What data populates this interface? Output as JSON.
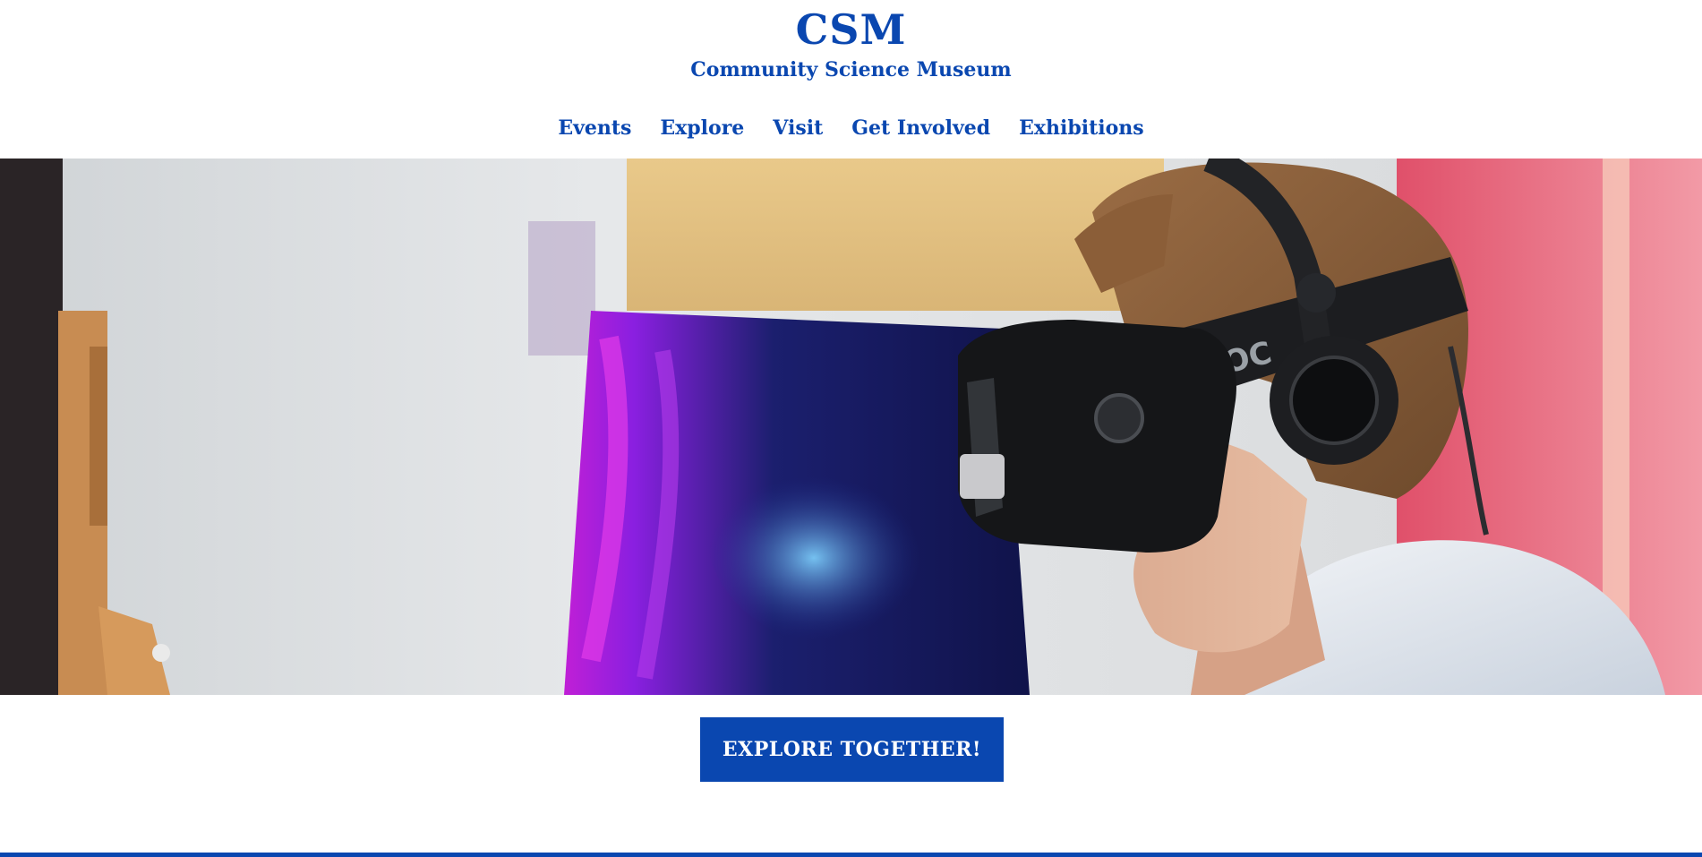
{
  "site": {
    "logo": "CSM",
    "tagline": "Community Science Museum"
  },
  "nav": {
    "items": [
      {
        "label": "Events"
      },
      {
        "label": "Explore"
      },
      {
        "label": "Visit"
      },
      {
        "label": "Get Involved"
      },
      {
        "label": "Exhibitions"
      }
    ]
  },
  "hero": {
    "image_subject": "person wearing virtual reality headset with headphones"
  },
  "cta": {
    "label": "EXPLORE TOGETHER!"
  },
  "colors": {
    "brand_blue": "#0a47b0",
    "background": "#ffffff"
  }
}
